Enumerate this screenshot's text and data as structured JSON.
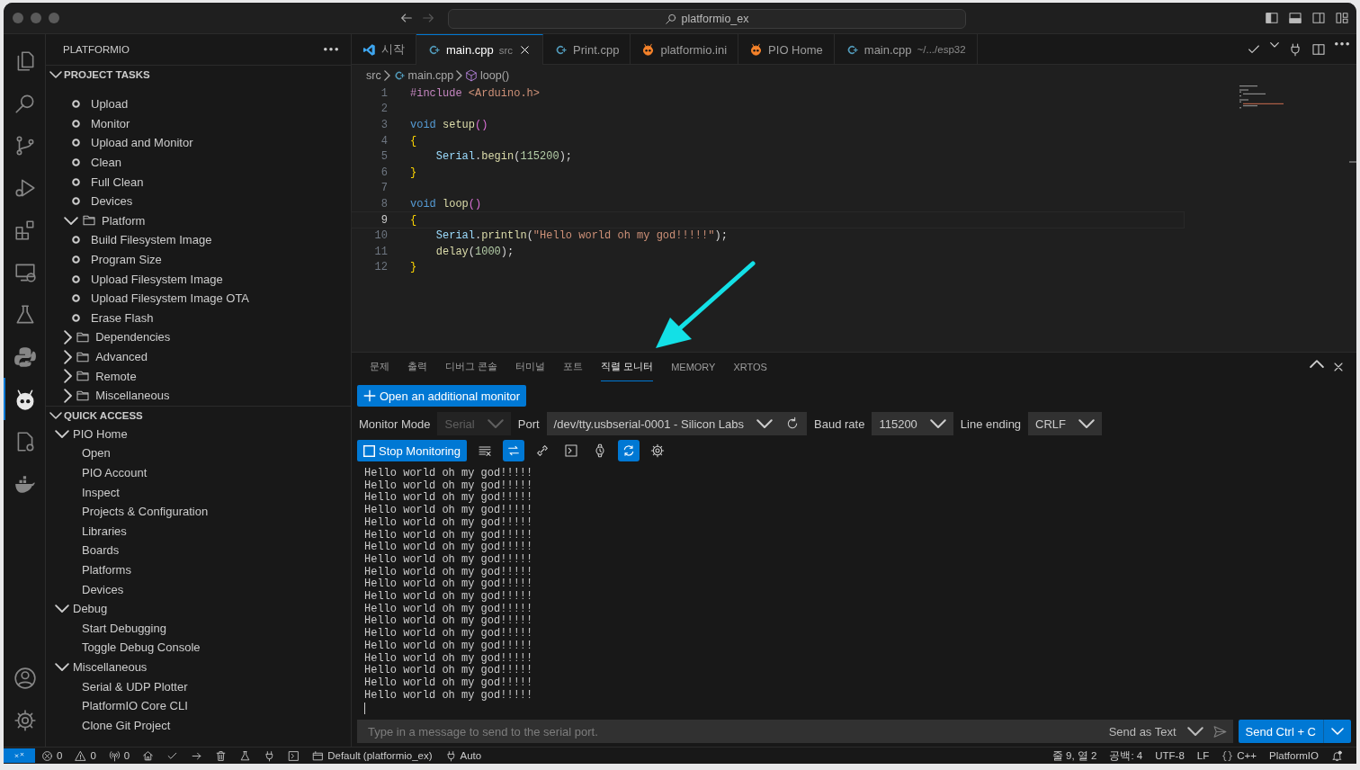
{
  "title_bar": {
    "search": "platformio_ex"
  },
  "activity_bar": [
    {
      "kind": "files",
      "selected": false
    },
    {
      "kind": "search",
      "selected": false
    },
    {
      "kind": "branch",
      "selected": false
    },
    {
      "kind": "debug",
      "selected": false
    },
    {
      "kind": "extensions",
      "selected": false
    },
    {
      "kind": "remote",
      "selected": false
    },
    {
      "kind": "flask",
      "selected": false
    },
    {
      "kind": "snake",
      "selected": false
    },
    {
      "kind": "alien",
      "selected": true
    },
    {
      "kind": "cppgear",
      "selected": false
    },
    {
      "kind": "whale",
      "selected": false
    }
  ],
  "activity_bar_bottom": [
    {
      "kind": "account"
    },
    {
      "kind": "gear"
    }
  ],
  "sidebar": {
    "title": "PLATFORMIO",
    "sections": [
      {
        "title": "PROJECT TASKS",
        "expanded": true,
        "items": [
          {
            "label": "Upload",
            "kind": "task"
          },
          {
            "label": "Monitor",
            "kind": "task"
          },
          {
            "label": "Upload and Monitor",
            "kind": "task"
          },
          {
            "label": "Clean",
            "kind": "task"
          },
          {
            "label": "Full Clean",
            "kind": "task"
          },
          {
            "label": "Devices",
            "kind": "task"
          },
          {
            "label": "Platform",
            "kind": "folder",
            "expanded": true,
            "children": [
              {
                "label": "Build Filesystem Image",
                "kind": "task"
              },
              {
                "label": "Program Size",
                "kind": "task"
              },
              {
                "label": "Upload Filesystem Image",
                "kind": "task"
              },
              {
                "label": "Upload Filesystem Image OTA",
                "kind": "task"
              },
              {
                "label": "Erase Flash",
                "kind": "task"
              }
            ]
          },
          {
            "label": "Dependencies",
            "kind": "folder",
            "expanded": false
          },
          {
            "label": "Advanced",
            "kind": "folder",
            "expanded": false
          },
          {
            "label": "Remote",
            "kind": "folder",
            "expanded": false
          },
          {
            "label": "Miscellaneous",
            "kind": "folder",
            "expanded": false
          }
        ]
      },
      {
        "title": "QUICK ACCESS",
        "expanded": true,
        "items": [
          {
            "label": "PIO Home",
            "kind": "group",
            "expanded": true,
            "children": [
              {
                "label": "Open",
                "kind": "leaf"
              },
              {
                "label": "PIO Account",
                "kind": "leaf"
              },
              {
                "label": "Inspect",
                "kind": "leaf"
              },
              {
                "label": "Projects & Configuration",
                "kind": "leaf"
              },
              {
                "label": "Libraries",
                "kind": "leaf"
              },
              {
                "label": "Boards",
                "kind": "leaf"
              },
              {
                "label": "Platforms",
                "kind": "leaf"
              },
              {
                "label": "Devices",
                "kind": "leaf"
              }
            ]
          },
          {
            "label": "Debug",
            "kind": "group",
            "expanded": true,
            "children": [
              {
                "label": "Start Debugging",
                "kind": "leaf"
              },
              {
                "label": "Toggle Debug Console",
                "kind": "leaf"
              }
            ]
          },
          {
            "label": "Miscellaneous",
            "kind": "group",
            "expanded": true,
            "children": [
              {
                "label": "Serial & UDP Plotter",
                "kind": "leaf"
              },
              {
                "label": "PlatformIO Core CLI",
                "kind": "leaf"
              },
              {
                "label": "Clone Git Project",
                "kind": "leaf"
              }
            ]
          }
        ]
      }
    ]
  },
  "editor": {
    "tabs": [
      {
        "label": "시작",
        "kind": "welcome",
        "selected": false
      },
      {
        "label": "main.cpp",
        "description": "src",
        "kind": "cpp",
        "selected": true
      },
      {
        "label": "Print.cpp",
        "kind": "cpp",
        "selected": false
      },
      {
        "label": "platformio.ini",
        "kind": "pio",
        "selected": false
      },
      {
        "label": "PIO Home",
        "kind": "pio",
        "selected": false
      },
      {
        "label": "main.cpp",
        "description": "~/.../esp32",
        "kind": "cpp",
        "selected": false
      }
    ],
    "breadcrumb": [
      {
        "label": "src",
        "kind": "folder"
      },
      {
        "label": "main.cpp",
        "kind": "cpp"
      },
      {
        "label": "loop()",
        "kind": "method"
      }
    ],
    "lines": [
      {
        "number": "1",
        "current": false,
        "tokens": [
          {
            "t": "#include",
            "color": "#c586c0"
          },
          {
            "t": " <Arduino.h>",
            "color": "#ce9178"
          }
        ]
      },
      {
        "number": "2",
        "current": false
      },
      {
        "number": "3",
        "current": false,
        "tokens": [
          {
            "t": "void",
            "color": "#569cd6"
          },
          {
            "t": " setup",
            "color": "#dcdcaa"
          },
          {
            "t": "()",
            "color": "#da70d6"
          }
        ]
      },
      {
        "number": "4",
        "current": false,
        "tokens": [
          {
            "t": "{",
            "color": "#ffd700"
          }
        ]
      },
      {
        "number": "5",
        "current": false,
        "tokens": [
          {
            "t": "    Serial",
            "color": "#9cdcfe"
          },
          {
            "t": "."
          },
          {
            "t": "begin",
            "color": "#dcdcaa"
          },
          {
            "t": "("
          },
          {
            "t": "115200",
            "color": "#b5cea8"
          },
          {
            "t": ");"
          }
        ]
      },
      {
        "number": "6",
        "current": false,
        "tokens": [
          {
            "t": "}",
            "color": "#ffd700"
          }
        ]
      },
      {
        "number": "7",
        "current": false
      },
      {
        "number": "8",
        "current": false,
        "tokens": [
          {
            "t": "void",
            "color": "#569cd6"
          },
          {
            "t": " loop",
            "color": "#dcdcaa"
          },
          {
            "t": "()",
            "color": "#da70d6"
          }
        ]
      },
      {
        "number": "9",
        "current": true,
        "tokens": [
          {
            "t": "{",
            "color": "#ffd700"
          }
        ]
      },
      {
        "number": "10",
        "current": false,
        "tokens": [
          {
            "t": "    Serial",
            "color": "#9cdcfe"
          },
          {
            "t": "."
          },
          {
            "t": "println",
            "color": "#dcdcaa"
          },
          {
            "t": "("
          },
          {
            "t": "\"Hello world oh my god!!!!!\"",
            "color": "#ce9178"
          },
          {
            "t": ");"
          }
        ]
      },
      {
        "number": "11",
        "current": false,
        "tokens": [
          {
            "t": "    delay",
            "color": "#dcdcaa"
          },
          {
            "t": "("
          },
          {
            "t": "1000",
            "color": "#b5cea8"
          },
          {
            "t": ");"
          }
        ]
      },
      {
        "number": "12",
        "current": false,
        "tokens": [
          {
            "t": "}",
            "color": "#ffd700"
          }
        ]
      }
    ]
  },
  "panel": {
    "tabs": [
      {
        "label": "문제",
        "selected": false
      },
      {
        "label": "출력",
        "selected": false
      },
      {
        "label": "디버그 콘솔",
        "selected": false
      },
      {
        "label": "터미널",
        "selected": false
      },
      {
        "label": "포트",
        "selected": false
      },
      {
        "label": "직렬 모니터",
        "selected": true
      },
      {
        "label": "MEMORY",
        "selected": false
      },
      {
        "label": "XRTOS",
        "selected": false
      }
    ],
    "add_monitor_button": "Open an additional monitor",
    "fields": [
      {
        "label": "Monitor Mode",
        "value": "Serial",
        "disabled": true,
        "refresh": false
      },
      {
        "label": "Port",
        "value": "/dev/tty.usbserial-0001 - Silicon Labs",
        "disabled": false,
        "refresh": true
      },
      {
        "label": "Baud rate",
        "value": "115200",
        "disabled": false,
        "refresh": false
      },
      {
        "label": "Line ending",
        "value": "CRLF",
        "disabled": false,
        "refresh": false
      }
    ],
    "stop_button": "Stop Monitoring",
    "tools": [
      {
        "kind": "clear",
        "on": false
      },
      {
        "kind": "swap",
        "on": true
      },
      {
        "kind": "link",
        "on": false
      },
      {
        "kind": "terminal",
        "on": false
      },
      {
        "kind": "watch",
        "on": false
      },
      {
        "kind": "sync",
        "on": true
      },
      {
        "kind": "gear",
        "on": false
      }
    ],
    "output": [
      "Hello world oh my god!!!!!",
      "Hello world oh my god!!!!!",
      "Hello world oh my god!!!!!",
      "Hello world oh my god!!!!!",
      "Hello world oh my god!!!!!",
      "Hello world oh my god!!!!!",
      "Hello world oh my god!!!!!",
      "Hello world oh my god!!!!!",
      "Hello world oh my god!!!!!",
      "Hello world oh my god!!!!!",
      "Hello world oh my god!!!!!",
      "Hello world oh my god!!!!!",
      "Hello world oh my god!!!!!",
      "Hello world oh my god!!!!!",
      "Hello world oh my god!!!!!",
      "Hello world oh my god!!!!!",
      "Hello world oh my god!!!!!",
      "Hello world oh my god!!!!!",
      "Hello world oh my god!!!!!"
    ],
    "input": {
      "placeholder": "Type in a message to send to the serial port."
    },
    "send_mode": "Send as Text",
    "send_button": "Send Ctrl + C"
  },
  "status_bar": {
    "left": [
      {
        "kind": "remote"
      },
      {
        "kind": "error",
        "text": "0"
      },
      {
        "kind": "warning",
        "text": "0"
      },
      {
        "kind": "antenna",
        "text": "0"
      },
      {
        "kind": "home"
      },
      {
        "kind": "check"
      },
      {
        "kind": "arrow"
      },
      {
        "kind": "trash"
      },
      {
        "kind": "flask"
      },
      {
        "kind": "plug"
      },
      {
        "kind": "terminal"
      },
      {
        "kind": "env",
        "text": "Default (platformio_ex)"
      },
      {
        "kind": "plug",
        "text": "Auto"
      }
    ],
    "right": [
      {
        "kind": "text",
        "text": "줄 9, 열 2"
      },
      {
        "kind": "text",
        "text": "공백: 4"
      },
      {
        "kind": "text",
        "text": "UTF-8"
      },
      {
        "kind": "text",
        "text": "LF"
      },
      {
        "kind": "braces",
        "text": "C++"
      },
      {
        "kind": "text",
        "text": "PlatformIO"
      },
      {
        "kind": "bell"
      }
    ]
  }
}
